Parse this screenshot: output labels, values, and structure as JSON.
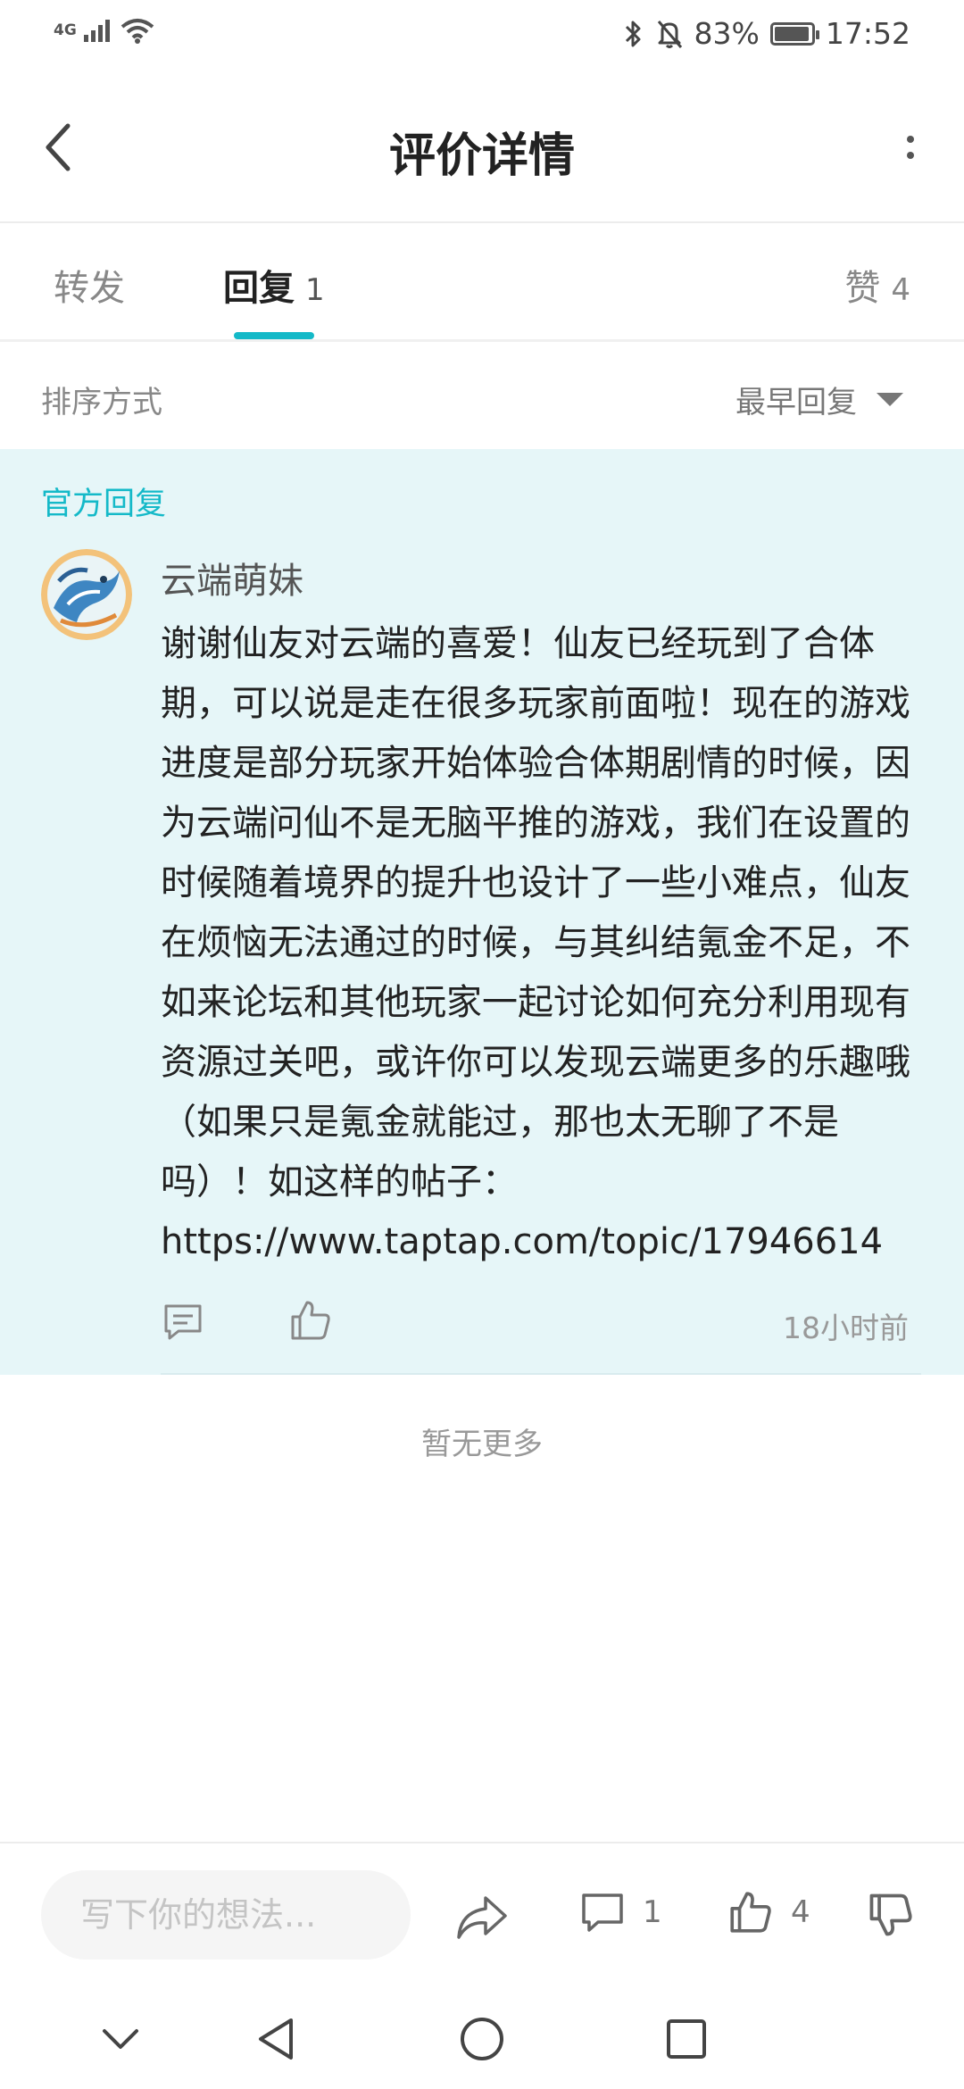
{
  "status_bar": {
    "network": "4G",
    "battery": "83%",
    "time": "17:52"
  },
  "header": {
    "title": "评价详情"
  },
  "tabs": [
    {
      "label": "转发",
      "count": ""
    },
    {
      "label": "回复",
      "count": "1"
    },
    {
      "label": "赞",
      "count": "4"
    }
  ],
  "sort": {
    "label": "排序方式",
    "value": "最早回复"
  },
  "official_reply": {
    "section_label": "官方回复",
    "author": "云端萌妹",
    "content": "谢谢仙友对云端的喜爱！仙友已经玩到了合体期，可以说是走在很多玩家前面啦！现在的游戏进度是部分玩家开始体验合体期剧情的时候，因为云端问仙不是无脑平推的游戏，我们在设置的时候随着境界的提升也设计了一些小难点，仙友在烦恼无法通过的时候，与其纠结氪金不足，不如来论坛和其他玩家一起讨论如何充分利用现有资源过关吧，或许你可以发现云端更多的乐趣哦（如果只是氪金就能过，那也太无聊了不是吗）！如这样的帖子：",
    "link": "https://www.taptap.com/topic/17946614",
    "time": "18小时前"
  },
  "list_end": "暂无更多",
  "bottom_bar": {
    "input_placeholder": "写下你的想法...",
    "comment_count": "1",
    "like_count": "4"
  },
  "colors": {
    "accent": "#14b9c8",
    "official_bg": "#e6f6f8"
  },
  "icons": [
    "signal-icon",
    "wifi-icon",
    "bluetooth-icon",
    "mute-bell-icon",
    "battery-icon",
    "back-arrow-icon",
    "more-vertical-icon",
    "dropdown-caret-icon",
    "comment-icon",
    "thumbs-up-icon",
    "share-icon",
    "thumbs-down-icon",
    "nav-back-icon",
    "nav-home-icon",
    "nav-recents-icon"
  ]
}
